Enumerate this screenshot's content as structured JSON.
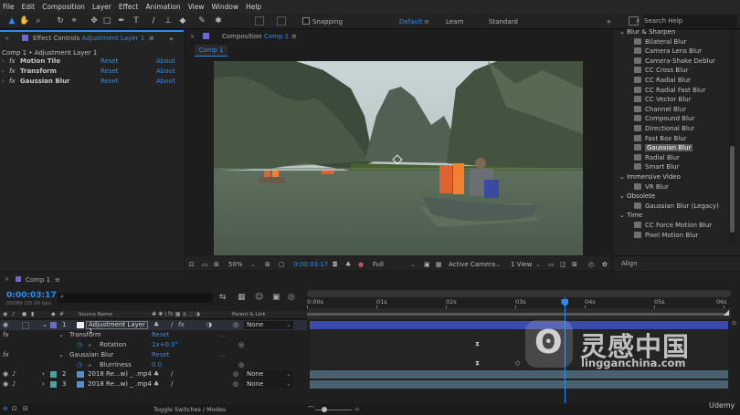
{
  "menu": [
    "File",
    "Edit",
    "Composition",
    "Layer",
    "Effect",
    "Animation",
    "View",
    "Window",
    "Help"
  ],
  "toolbar": {
    "snapping": "Snapping",
    "workspaces": [
      "Default",
      "Learn",
      "Standard"
    ],
    "search_placeholder": "Search Help"
  },
  "effect_controls": {
    "tab_label": "Effect Controls",
    "tab_layer": "Adjustment Layer 1",
    "subtitle": "Comp 1 • Adjustment Layer 1",
    "rows": [
      {
        "name": "Motion Tile",
        "reset": "Reset",
        "about": "About"
      },
      {
        "name": "Transform",
        "reset": "Reset",
        "about": "About"
      },
      {
        "name": "Gaussian Blur",
        "reset": "Reset",
        "about": "About"
      }
    ]
  },
  "composition": {
    "tab_label": "Composition",
    "tab_comp": "Comp 1",
    "sub_tab": "Comp 1"
  },
  "viewer_bar": {
    "zoom": "50%",
    "timecode": "0:00:03:17",
    "resolution": "Full",
    "camera": "Active Camera",
    "views": "1 View"
  },
  "effects_panel": {
    "items": [
      {
        "type": "cat",
        "label": "Blur & Sharpen"
      },
      {
        "type": "fx",
        "label": "Bilateral Blur"
      },
      {
        "type": "fx",
        "label": "Camera Lens Blur"
      },
      {
        "type": "fx",
        "label": "Camera-Shake Deblur"
      },
      {
        "type": "fx",
        "label": "CC Cross Blur"
      },
      {
        "type": "fx",
        "label": "CC Radial Blur"
      },
      {
        "type": "fx",
        "label": "CC Radial Fast Blur"
      },
      {
        "type": "fx",
        "label": "CC Vector Blur"
      },
      {
        "type": "fx",
        "label": "Channel Blur"
      },
      {
        "type": "fx",
        "label": "Compound Blur"
      },
      {
        "type": "fx",
        "label": "Directional Blur"
      },
      {
        "type": "fx",
        "label": "Fast Box Blur"
      },
      {
        "type": "fx",
        "label": "Gaussian Blur",
        "selected": true
      },
      {
        "type": "fx",
        "label": "Radial Blur"
      },
      {
        "type": "fx",
        "label": "Smart Blur"
      },
      {
        "type": "cat",
        "label": "Immersive Video"
      },
      {
        "type": "fx",
        "label": "VR Blur"
      },
      {
        "type": "cat",
        "label": "Obsolete"
      },
      {
        "type": "fx",
        "label": "Gaussian Blur (Legacy)"
      },
      {
        "type": "cat",
        "label": "Time"
      },
      {
        "type": "fx",
        "label": "CC Force Motion Blur"
      },
      {
        "type": "fx",
        "label": "Pixel Motion Blur"
      }
    ],
    "align_label": "Align"
  },
  "timeline": {
    "tab_label": "Comp 1",
    "timecode": "0:00:03:17",
    "frames": "00089 (25.00 fps)",
    "search_placeholder": "",
    "col_source": "Source Name",
    "col_parent": "Parent & Link",
    "ruler": [
      "0:00s",
      "01s",
      "02s",
      "03s",
      "04s",
      "05s",
      "06s"
    ],
    "playhead_fraction": 0.613,
    "layers": [
      {
        "num": "1",
        "name": "Adjustment Layer 1",
        "parent": "None"
      },
      {
        "num": "2",
        "name": "2018 Re...w) _ .mp4",
        "parent": "None"
      },
      {
        "num": "3",
        "name": "2018 Re...w) _ .mp4",
        "parent": "None"
      }
    ],
    "props": {
      "transform": "Transform",
      "transform_reset": "Reset",
      "rotation": "Rotation",
      "rotation_val": "1x+0.0°",
      "blur": "Gaussian Blur",
      "blur_reset": "Reset",
      "blurriness": "Blurriness",
      "blurriness_val": "0.0"
    },
    "toggle": "Toggle Switches / Modes"
  },
  "watermark": {
    "cn": "灵感中国",
    "url": "lingganchina.com",
    "udemy": "Udemy"
  },
  "colors": {
    "accent": "#2d8ceb",
    "layer_adj": "#3a4bb0",
    "layer_video": "#4a6170",
    "label_teal": "#47a5a5"
  }
}
